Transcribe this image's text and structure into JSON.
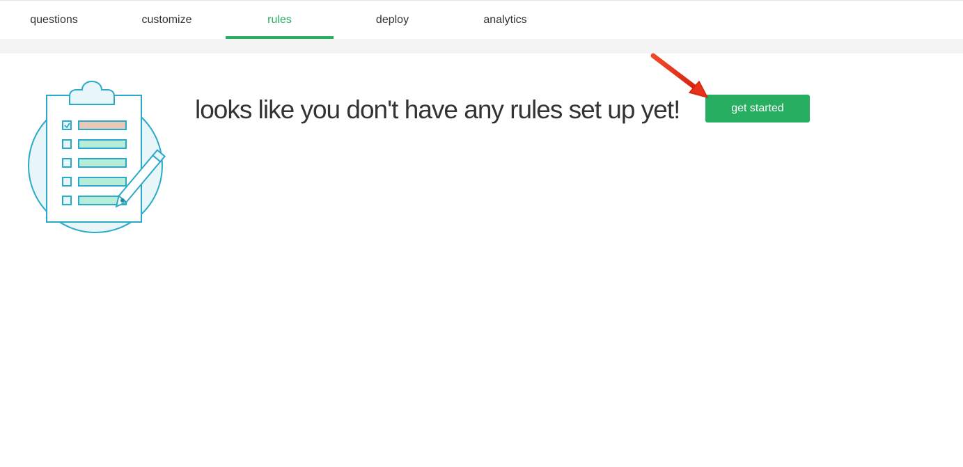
{
  "tabs": [
    {
      "label": "questions",
      "active": false
    },
    {
      "label": "customize",
      "active": false
    },
    {
      "label": "rules",
      "active": true
    },
    {
      "label": "deploy",
      "active": false
    },
    {
      "label": "analytics",
      "active": false
    }
  ],
  "empty_state": {
    "message": "looks like you don't have any rules set up yet!",
    "button_label": "get started",
    "illustration": "clipboard-checklist-icon"
  },
  "annotation": {
    "icon": "red-arrow-icon"
  },
  "colors": {
    "accent": "#27ae60",
    "text": "#333333",
    "illustration_stroke": "#2aa9c9",
    "illustration_fill": "#e9f6f9",
    "row_fill": "#b7ecd9",
    "checked_row_fill": "#e8c9b8",
    "arrow": "#e8311a"
  }
}
